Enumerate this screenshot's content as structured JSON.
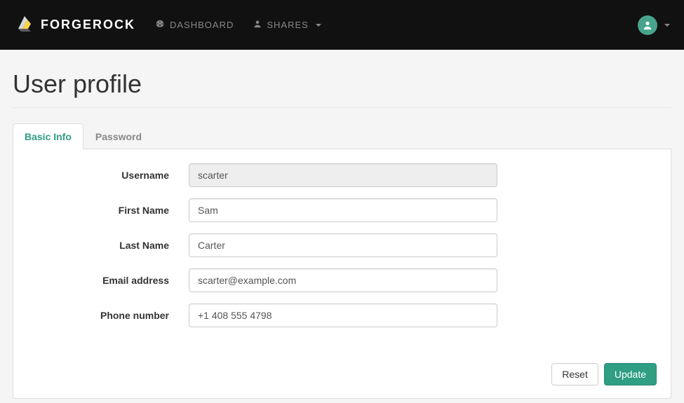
{
  "brand": {
    "name": "FORGEROCK"
  },
  "nav": {
    "dashboard": "DASHBOARD",
    "shares": "SHARES"
  },
  "page": {
    "title": "User profile"
  },
  "tabs": {
    "basic": "Basic Info",
    "password": "Password"
  },
  "form": {
    "username": {
      "label": "Username",
      "value": "scarter"
    },
    "first_name": {
      "label": "First Name",
      "value": "Sam"
    },
    "last_name": {
      "label": "Last Name",
      "value": "Carter"
    },
    "email": {
      "label": "Email address",
      "value": "scarter@example.com"
    },
    "phone": {
      "label": "Phone number",
      "value": "+1 408 555 4798"
    }
  },
  "buttons": {
    "reset": "Reset",
    "update": "Update"
  }
}
